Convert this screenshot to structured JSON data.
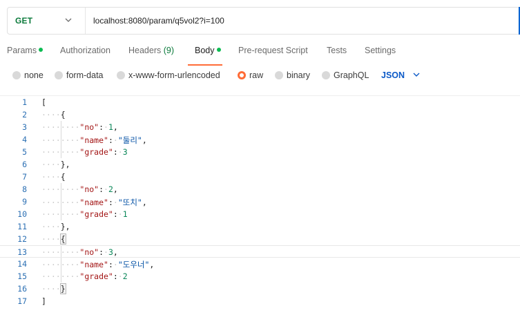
{
  "request": {
    "method": "GET",
    "url": "localhost:8080/param/q5vol2?i=100"
  },
  "tabs": [
    {
      "label": "Params",
      "dot": true
    },
    {
      "label": "Authorization"
    },
    {
      "label": "Headers",
      "count": "(9)"
    },
    {
      "label": "Body",
      "dot": true,
      "active": true
    },
    {
      "label": "Pre-request Script"
    },
    {
      "label": "Tests"
    },
    {
      "label": "Settings"
    }
  ],
  "body_types": [
    {
      "label": "none"
    },
    {
      "label": "form-data"
    },
    {
      "label": "x-www-form-urlencoded"
    },
    {
      "label": "raw",
      "selected": true
    },
    {
      "label": "binary"
    },
    {
      "label": "GraphQL"
    }
  ],
  "format": "JSON",
  "editor": {
    "line_numbers": [
      "1",
      "2",
      "3",
      "4",
      "5",
      "6",
      "7",
      "8",
      "9",
      "10",
      "11",
      "12",
      "13",
      "14",
      "15",
      "16",
      "17"
    ],
    "items": [
      {
        "no": "1",
        "name": "\"둘리\"",
        "grade": "3"
      },
      {
        "no": "2",
        "name": "\"또치\"",
        "grade": "1"
      },
      {
        "no": "3",
        "name": "\"도우너\"",
        "grade": "2"
      }
    ],
    "key_no": "\"no\"",
    "key_name": "\"name\"",
    "key_grade": "\"grade\"",
    "open_array": "[",
    "close_array": "]",
    "open_obj": "{",
    "close_obj": "},",
    "close_obj_last": "}"
  },
  "colors": {
    "accent": "#ff6c37",
    "method_get": "#0b7a3b",
    "json_blue": "#0b59c7"
  }
}
